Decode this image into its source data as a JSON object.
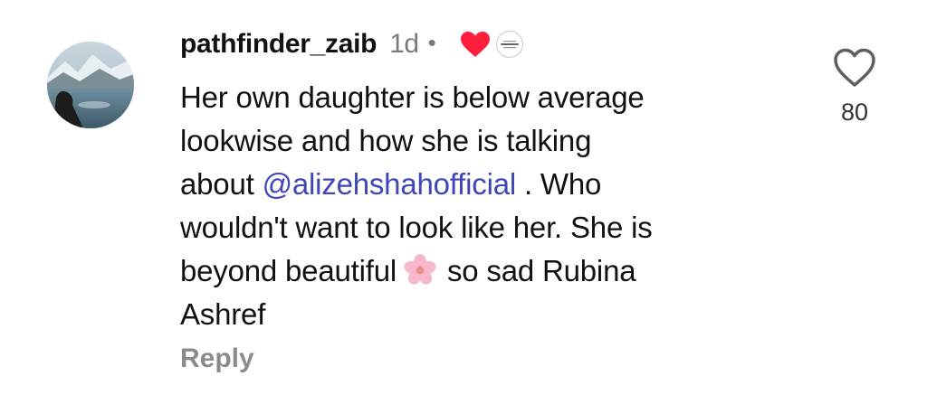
{
  "comment": {
    "username": "pathfinder_zaib",
    "time": "1d",
    "separator": "•",
    "text_lines": [
      {
        "before": "Her own daughter is below average"
      },
      {
        "before": "lookwise and how she is talking"
      },
      {
        "before": "about ",
        "mention": "@alizehshahofficial",
        "after": " . Who"
      },
      {
        "before": "wouldn't want to look like her. She is"
      },
      {
        "before": "beyond beautiful",
        "emoji": "cherry-blossom",
        "after": "so sad Rubina"
      },
      {
        "before": "Ashref"
      }
    ],
    "reply_label": "Reply",
    "like_count": "80",
    "author_like_icon": "red-heart-icon",
    "author_badge_icon": "author-avatar-icon"
  },
  "colors": {
    "mention": "#3f46b8",
    "author_heart": "#ff1f3d",
    "muted_text": "#8b8b8b"
  }
}
